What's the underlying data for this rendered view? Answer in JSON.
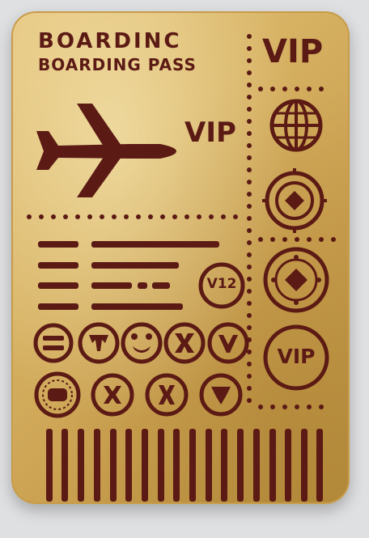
{
  "pass": {
    "title": "BOARDINC",
    "subtitle": "BOARDING PASS",
    "class_badge": "VIP",
    "class_label": "VIP",
    "seat_badge": "V12",
    "vip_stamp": "VIP"
  },
  "icons": [
    "airplane-icon",
    "globe-icon",
    "diamond-icon",
    "compass-icon",
    "vip-stamp-icon"
  ],
  "colors": {
    "card_gold": "#d7b263",
    "cutout_maroon": "#5b1a14",
    "background": "#dfe0e2"
  }
}
